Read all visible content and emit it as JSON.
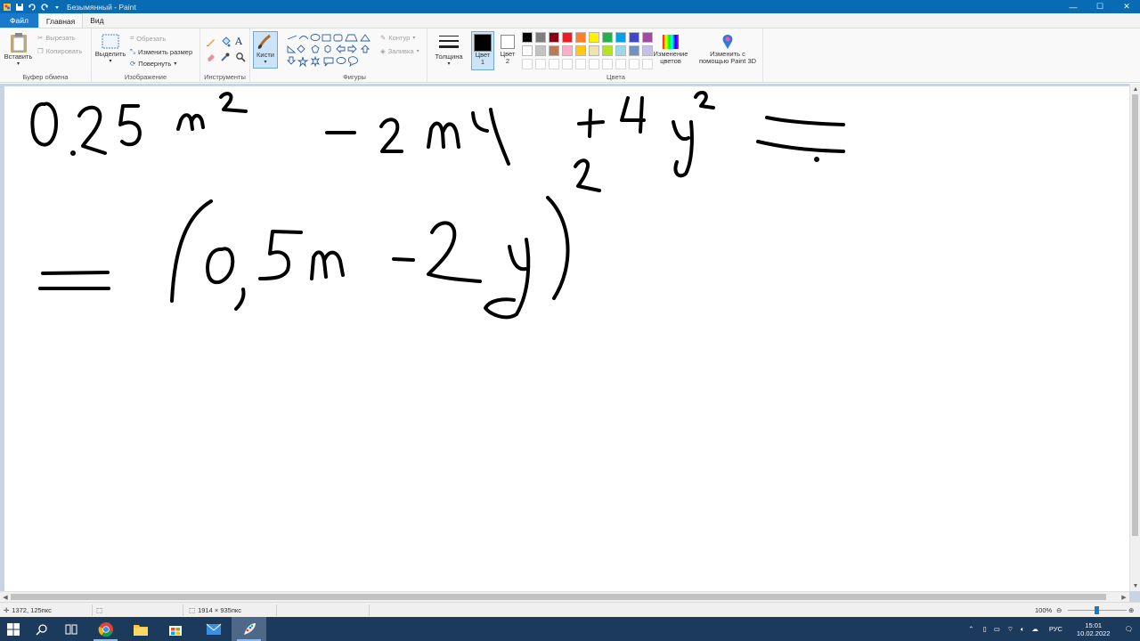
{
  "window": {
    "title": "Безымянный - Paint",
    "controls": {
      "minimize": "—",
      "maximize": "☐",
      "close": "✕"
    }
  },
  "menu": {
    "tabs": [
      "Файл",
      "Главная",
      "Вид"
    ]
  },
  "ribbon": {
    "clipboard": {
      "label": "Буфер обмена",
      "paste": "Вставить",
      "cut": "Вырезать",
      "copy": "Копировать"
    },
    "image": {
      "label": "Изображение",
      "select": "Выделить",
      "crop": "Обрезать",
      "resize": "Изменить размер",
      "rotate": "Повернуть"
    },
    "tools": {
      "label": "Инструменты"
    },
    "brushes": {
      "label": "Кисти"
    },
    "shapes": {
      "label": "Фигуры",
      "outline": "Контур",
      "fill": "Заливка"
    },
    "size": {
      "label": "Толщина"
    },
    "colors": {
      "label": "Цвета",
      "color1_line1": "Цвет",
      "color1_line2": "1",
      "color2_line1": "Цвет",
      "color2_line2": "2",
      "edit_line1": "Изменение",
      "edit_line2": "цветов",
      "paint3d_line1": "Изменить с",
      "paint3d_line2": "помощью Paint 3D",
      "palette": [
        "#000000",
        "#7f7f7f",
        "#880015",
        "#ed1c24",
        "#ff7f27",
        "#fff200",
        "#22b14c",
        "#00a2e8",
        "#3f48cc",
        "#a349a4",
        "#ffffff",
        "#c3c3c3",
        "#b97a57",
        "#ffaec9",
        "#ffc90e",
        "#efe4b0",
        "#b5e61d",
        "#99d9ea",
        "#7092be",
        "#c8bfe7"
      ]
    }
  },
  "status": {
    "cursor_pos": "1372, 125пкс",
    "image_size": "1914 × 935пкс",
    "zoom": "100%",
    "zoom_level_percent": 100
  },
  "taskbar": {
    "language": "РУС",
    "time": "15:01",
    "date": "10.02.2022"
  }
}
